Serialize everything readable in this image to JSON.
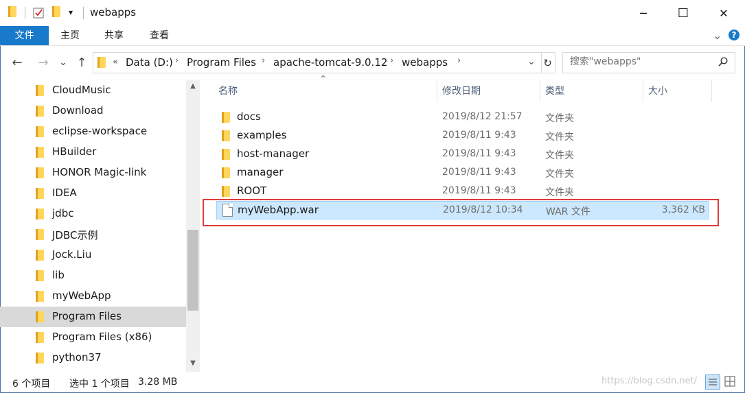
{
  "window": {
    "title": "webapps",
    "quick_access_dropdown": "▾",
    "minimize": "─",
    "maximize": "☐",
    "close": "✕"
  },
  "ribbon": {
    "tabs": [
      "文件",
      "主页",
      "共享",
      "查看"
    ],
    "expand_chevron": "⌄",
    "help": "?"
  },
  "address": {
    "back": "←",
    "forward": "→",
    "recent": "⌄",
    "up": "↑",
    "overflow": "«",
    "crumbs": [
      "Data (D:)",
      "Program Files",
      "apache-tomcat-9.0.12",
      "webapps"
    ],
    "refresh": "↻"
  },
  "search": {
    "placeholder": "搜索\"webapps\""
  },
  "sidebar": {
    "items": [
      {
        "label": "CloudMusic"
      },
      {
        "label": "Download"
      },
      {
        "label": "eclipse-workspace"
      },
      {
        "label": "HBuilder"
      },
      {
        "label": "HONOR Magic-link"
      },
      {
        "label": "IDEA"
      },
      {
        "label": "jdbc"
      },
      {
        "label": "JDBC示例"
      },
      {
        "label": "Jock.Liu"
      },
      {
        "label": "lib"
      },
      {
        "label": "myWebApp"
      },
      {
        "label": "Program Files"
      },
      {
        "label": "Program Files (x86)"
      },
      {
        "label": "python37"
      }
    ],
    "selected_index": 11
  },
  "columns": {
    "name": "名称",
    "date": "修改日期",
    "type": "类型",
    "size": "大小",
    "sort_arrow": "^"
  },
  "files": [
    {
      "name": "docs",
      "date": "2019/8/12 21:57",
      "type": "文件夹",
      "size": "",
      "kind": "folder"
    },
    {
      "name": "examples",
      "date": "2019/8/11 9:43",
      "type": "文件夹",
      "size": "",
      "kind": "folder"
    },
    {
      "name": "host-manager",
      "date": "2019/8/11 9:43",
      "type": "文件夹",
      "size": "",
      "kind": "folder"
    },
    {
      "name": "manager",
      "date": "2019/8/11 9:43",
      "type": "文件夹",
      "size": "",
      "kind": "folder"
    },
    {
      "name": "ROOT",
      "date": "2019/8/11 9:43",
      "type": "文件夹",
      "size": "",
      "kind": "folder"
    },
    {
      "name": "myWebApp.war",
      "date": "2019/8/12 10:34",
      "type": "WAR 文件",
      "size": "3,362 KB",
      "kind": "file",
      "selected": true
    }
  ],
  "status": {
    "count": "6 个项目",
    "selection": "选中 1 个项目",
    "selection_size": "3.28 MB"
  },
  "watermark": "https://blog.csdn.net/",
  "colors": {
    "accent": "#1979ca",
    "selection": "#cce8ff",
    "highlight_box": "#e03b3b",
    "folder": "#ffd65c"
  }
}
